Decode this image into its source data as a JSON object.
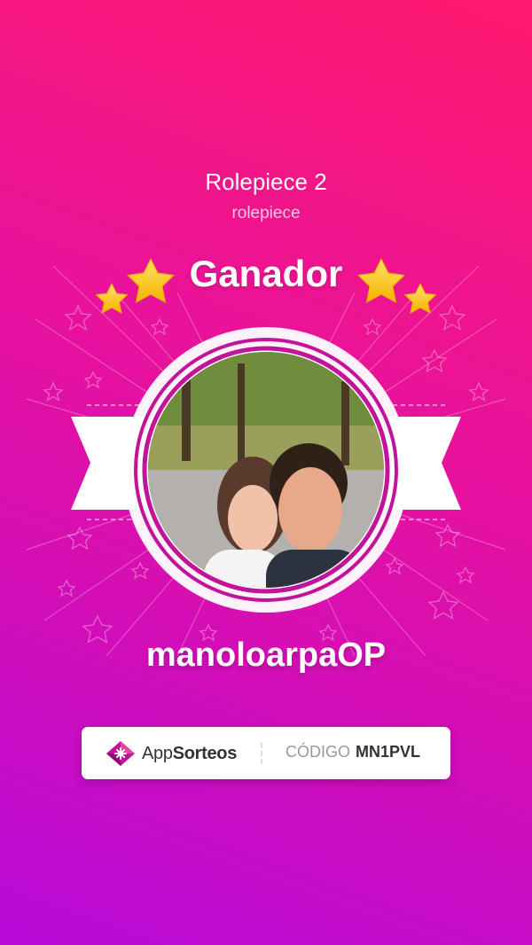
{
  "draw": {
    "title": "Rolepiece 2",
    "subtitle": "rolepiece"
  },
  "badge": {
    "label": "Ganador",
    "icons": [
      "star-icon"
    ]
  },
  "winner": {
    "username": "manoloarpaOP",
    "avatar_icon": "winner-photo"
  },
  "footer": {
    "brand_prefix": "App",
    "brand_bold": "Sorteos",
    "code_label": "CÓDIGO",
    "code_value": "MN1PVL"
  },
  "colors": {
    "gradient_start": "#ff1a6e",
    "gradient_end": "#b70ad8",
    "ring": "#c2139a",
    "star": "#ffc93a"
  }
}
